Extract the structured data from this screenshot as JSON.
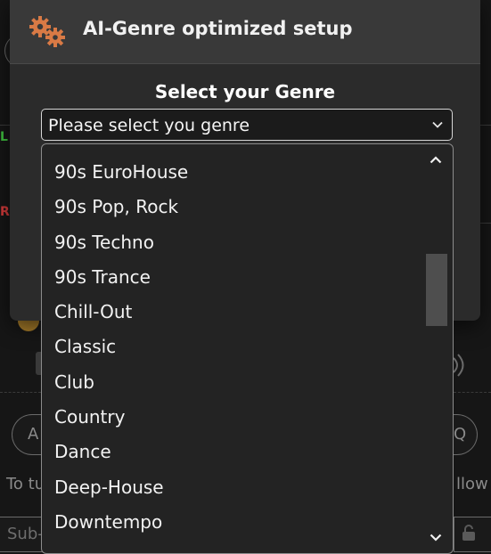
{
  "dialog": {
    "title": "AI-Genre optimized setup",
    "icon": "gears-icon",
    "accent_color": "#d97a45"
  },
  "genre_select": {
    "label": "Select your Genre",
    "value": "Please select you genre"
  },
  "dropdown": {
    "options": [
      "90s EuroHouse",
      "90s Pop, Rock",
      "90s Techno",
      "90s Trance",
      "Chill-Out",
      "Classic",
      "Club",
      "Country",
      "Dance",
      "Deep-House",
      "Downtempo"
    ]
  },
  "background": {
    "left_letters": [
      "L",
      "R",
      "A"
    ],
    "right_letters": [
      "Q"
    ],
    "bottom_left_text": "To tu",
    "bottom_right_text": "llow",
    "sub_input_text": "Sub-"
  }
}
